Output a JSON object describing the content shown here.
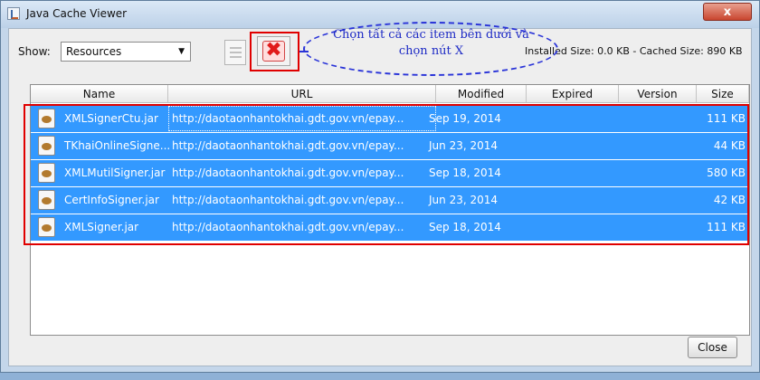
{
  "window": {
    "title": "Java Cache Viewer",
    "close_glyph": "x"
  },
  "toolbar": {
    "show_label": "Show:",
    "show_value": "Resources",
    "show_arrow": "▼",
    "size_info": "Installed Size: 0.0 KB - Cached Size: 890 KB",
    "delete_glyph": "✖"
  },
  "annotation": {
    "callout_text": "Chọn tất cả các item bên dưới và chọn nút X"
  },
  "table": {
    "columns": [
      "Name",
      "URL",
      "Modified",
      "Expired",
      "Version",
      "Size"
    ],
    "rows": [
      {
        "name": "XMLSignerCtu.jar",
        "url": "http://daotaonhantokhai.gdt.gov.vn/epay...",
        "modified": "Sep 19, 2014",
        "expired": "",
        "version": "",
        "size": "111 KB"
      },
      {
        "name": "TKhaiOnlineSigne...",
        "url": "http://daotaonhantokhai.gdt.gov.vn/epay...",
        "modified": "Jun 23, 2014",
        "expired": "",
        "version": "",
        "size": "44 KB"
      },
      {
        "name": "XMLMutilSigner.jar",
        "url": "http://daotaonhantokhai.gdt.gov.vn/epay...",
        "modified": "Sep 18, 2014",
        "expired": "",
        "version": "",
        "size": "580 KB"
      },
      {
        "name": "CertInfoSigner.jar",
        "url": "http://daotaonhantokhai.gdt.gov.vn/epay...",
        "modified": "Jun 23, 2014",
        "expired": "",
        "version": "",
        "size": "42 KB"
      },
      {
        "name": "XMLSigner.jar",
        "url": "http://daotaonhantokhai.gdt.gov.vn/epay...",
        "modified": "Sep 18, 2014",
        "expired": "",
        "version": "",
        "size": "111 KB"
      }
    ]
  },
  "footer": {
    "close_label": "Close"
  },
  "colors": {
    "selection": "#3399ff",
    "highlight": "#e00000",
    "callout": "#2a34d8"
  }
}
